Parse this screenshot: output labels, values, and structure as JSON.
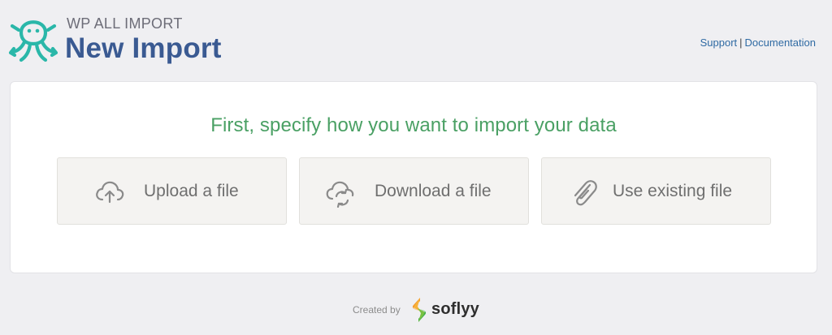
{
  "header": {
    "brand": "WP ALL IMPORT",
    "title": "New Import",
    "links": {
      "support": "Support",
      "separator": "|",
      "documentation": "Documentation"
    }
  },
  "main": {
    "prompt": "First, specify how you want to import your data",
    "options": [
      {
        "label": "Upload a file",
        "icon": "cloud-upload-icon"
      },
      {
        "label": "Download a file",
        "icon": "cloud-sync-icon"
      },
      {
        "label": "Use existing file",
        "icon": "paperclip-icon"
      }
    ]
  },
  "footer": {
    "created_by": "Created by",
    "company": "soflyy"
  },
  "colors": {
    "background": "#efeff2",
    "title": "#3a5a92",
    "prompt": "#4aa064",
    "logo": "#2ab7a9",
    "link": "#2f6aa3"
  }
}
